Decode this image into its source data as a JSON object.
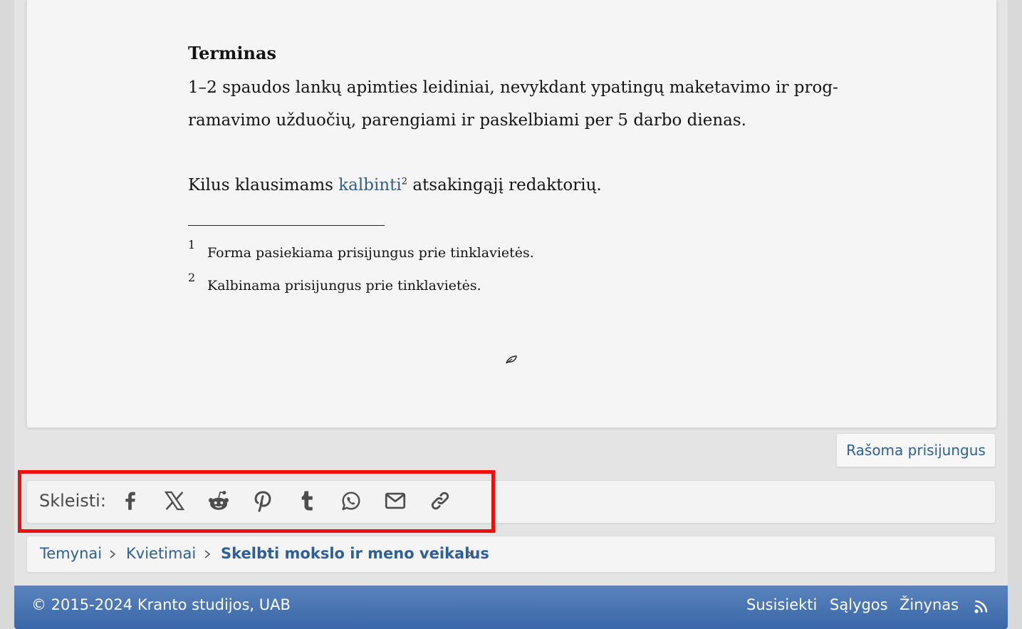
{
  "article": {
    "term_title": "Terminas",
    "term_text": "1–2 spaudos lankų apimties leidiniai, nevykdant ypatingų maketavimo ir prog- ramavimo užduočių, parengiami ir paskelbiami per 5 darbo dienas.",
    "ask_prefix": "Kilus klausimams",
    "ask_link": "kalbinti",
    "ask_sup": "2",
    "ask_suffix": "atsakingąjį redaktorių.",
    "footnotes": [
      {
        "num": "1",
        "text": "Forma pasiekiama prisijungus prie tinklavietės."
      },
      {
        "num": "2",
        "text": "Kalbinama prisijungus prie tinklavietės."
      }
    ],
    "end_icon": "leaf-icon"
  },
  "replies_button": "Rašoma prisijungus",
  "share": {
    "label": "Skleisti:",
    "icons": [
      "facebook-icon",
      "x-icon",
      "reddit-icon",
      "pinterest-icon",
      "tumblr-icon",
      "whatsapp-icon",
      "email-icon",
      "link-icon"
    ],
    "highlight_color": "#ee0f0f"
  },
  "breadcrumb": {
    "items": [
      "Temynai",
      "Kvietimai",
      "Skelbti mokslo ir meno veikalus"
    ]
  },
  "footer": {
    "copyright": "© 2015-2024 Kranto studijos, UAB",
    "links": [
      "Susisiekti",
      "Sąlygos",
      "Žinynas"
    ],
    "rss_icon": "rss-icon"
  },
  "colors": {
    "link": "#2d5f9a",
    "footer_top": "#5a83bd",
    "footer_bottom": "#3a67a8"
  }
}
